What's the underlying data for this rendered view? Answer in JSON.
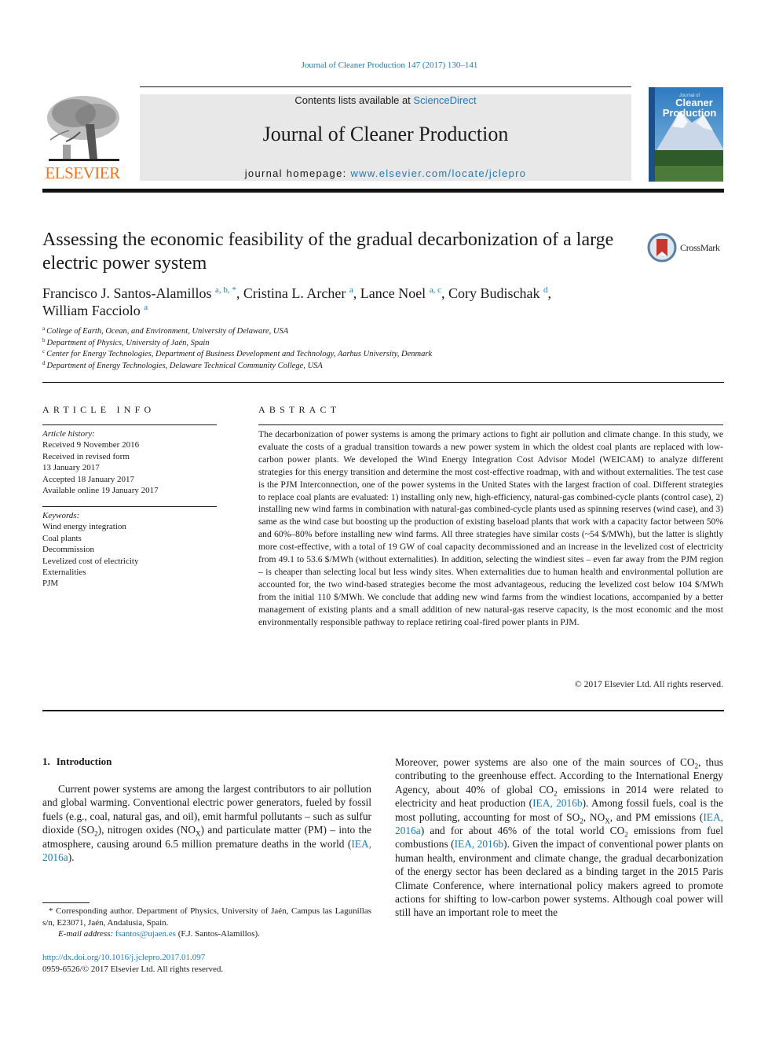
{
  "running_head": "Journal of Cleaner Production 147 (2017) 130–141",
  "masthead": {
    "publisher_logo_text": "ELSEVIER",
    "contents_prefix": "Contents lists available at ",
    "contents_link": "ScienceDirect",
    "journal_name": "Journal of Cleaner Production",
    "homepage_prefix": "journal homepage: ",
    "homepage_link": "www.elsevier.com/locate/jclepro",
    "cover": {
      "line1": "Journal of",
      "line2": "Cleaner",
      "line3": "Production"
    }
  },
  "colors": {
    "link": "#1f7ab5",
    "elsevier_orange": "#e87722",
    "masthead_bg": "#e8e8e8",
    "crossmark_red": "#c8372d"
  },
  "article": {
    "title": "Assessing the economic feasibility of the gradual decarbonization of a large electric power system",
    "crossmark_label": "CrossMark",
    "authors": [
      {
        "name": "Francisco J. Santos-Alamillos",
        "marks": "a, b, *"
      },
      {
        "name": "Cristina L. Archer",
        "marks": "a"
      },
      {
        "name": "Lance Noel",
        "marks": "a, c"
      },
      {
        "name": "Cory Budischak",
        "marks": "d"
      },
      {
        "name": "William Facciolo",
        "marks": "a"
      }
    ],
    "affiliations": [
      {
        "mark": "a",
        "text": "College of Earth, Ocean, and Environment, University of Delaware, USA"
      },
      {
        "mark": "b",
        "text": "Department of Physics, University of Jaén, Spain"
      },
      {
        "mark": "c",
        "text": "Center for Energy Technologies, Department of Business Development and Technology, Aarhus University, Denmark"
      },
      {
        "mark": "d",
        "text": "Department of Energy Technologies, Delaware Technical Community College, USA"
      }
    ]
  },
  "article_info": {
    "heading": "ARTICLE INFO",
    "history_label": "Article history:",
    "history": [
      "Received 9 November 2016",
      "Received in revised form",
      "13 January 2017",
      "Accepted 18 January 2017",
      "Available online 19 January 2017"
    ],
    "keywords_label": "Keywords:",
    "keywords": [
      "Wind energy integration",
      "Coal plants",
      "Decommission",
      "Levelized cost of electricity",
      "Externalities",
      "PJM"
    ]
  },
  "abstract": {
    "heading": "ABSTRACT",
    "text": "The decarbonization of power systems is among the primary actions to fight air pollution and climate change. In this study, we evaluate the costs of a gradual transition towards a new power system in which the oldest coal plants are replaced with low-carbon power plants. We developed the Wind Energy Integration Cost Advisor Model (WEICAM) to analyze different strategies for this energy transition and determine the most cost-effective roadmap, with and without externalities. The test case is the PJM Interconnection, one of the power systems in the United States with the largest fraction of coal. Different strategies to replace coal plants are evaluated: 1) installing only new, high-efficiency, natural-gas combined-cycle plants (control case), 2) installing new wind farms in combination with natural-gas combined-cycle plants used as spinning reserves (wind case), and 3) same as the wind case but boosting up the production of existing baseload plants that work with a capacity factor between 50% and 60%–80% before installing new wind farms. All three strategies have similar costs (~54 $/MWh), but the latter is slightly more cost-effective, with a total of 19 GW of coal capacity decommissioned and an in­crease in the levelized cost of electricity from 49.1 to 53.6 $/MWh (without externalities). In addition, selecting the windiest sites – even far away from the PJM region – is cheaper than selecting local but less windy sites. When externalities due to human health and environmental pollution are accounted for, the two wind-based strategies become the most advantageous, reducing the levelized cost below 104 $/MWh from the initial 110 $/MWh. We conclude that adding new wind farms from the windiest lo­cations, accompanied by a better management of existing plants and a small addition of new natural-gas reserve capacity, is the most economic and the most environmentally responsible pathway to replace retiring coal-fired power plants in PJM.",
    "copyright": "© 2017 Elsevier Ltd. All rights reserved."
  },
  "introduction": {
    "number": "1.",
    "heading": "Introduction",
    "left": {
      "t1": "Current power systems are among the largest contributors to air pollution and global warming. Conventional electric power gener­ators, fueled by fossil fuels (e.g., coal, natural gas, and oil), emit harmful pollutants – such as sulfur dioxide (SO",
      "s1": "2",
      "t2": "), nitrogen oxides (NO",
      "s2": "X",
      "t3": ") and particulate matter (PM) – into the atmosphere, causing around 6.5 million premature deaths in the world (",
      "c1": "IEA, 2016a",
      "t4": ")."
    },
    "right": {
      "t1": "Moreover, power systems are also one of the main sources of CO",
      "s1": "2",
      "t2": ", thus contributing to the greenhouse effect. According to the Inter­national Energy Agency, about 40% of global CO",
      "s2": "2",
      "t3": " emissions in 2014 were related to electricity and heat production (",
      "c1": "IEA, 2016b",
      "t4": "). Among fossil fuels, coal is the most polluting, accounting for most of SO",
      "s3": "2",
      "t5": ", NO",
      "s4": "X",
      "t6": ", and PM emissions (",
      "c2": "IEA, 2016a",
      "t7": ") and for about 46% of the total world CO",
      "s5": "2",
      "t8": " emissions from fuel combustions (",
      "c3": "IEA, 2016b",
      "t9": "). Given the impact of conventional power plants on human health, environ­ment and climate change, the gradual decarbonization of the en­ergy sector has been declared as a binding target in the 2015 Paris Climate Conference, where international policy makers agreed to promote actions for shifting to low-carbon power systems. Although coal power will still have an important role to meet the"
    }
  },
  "footnotes": {
    "corresponding": "* Corresponding author. Department of Physics, University of Jaén, Campus las Lagunillas s/n, E23071, Jaén, Andalusia, Spain.",
    "email_label": "E-mail address:",
    "email": "fsantos@ujaen.es",
    "email_suffix": " (F.J. Santos-Alamillos).",
    "doi": "http://dx.doi.org/10.1016/j.jclepro.2017.01.097",
    "issn_line": "0959-6526/© 2017 Elsevier Ltd. All rights reserved."
  }
}
